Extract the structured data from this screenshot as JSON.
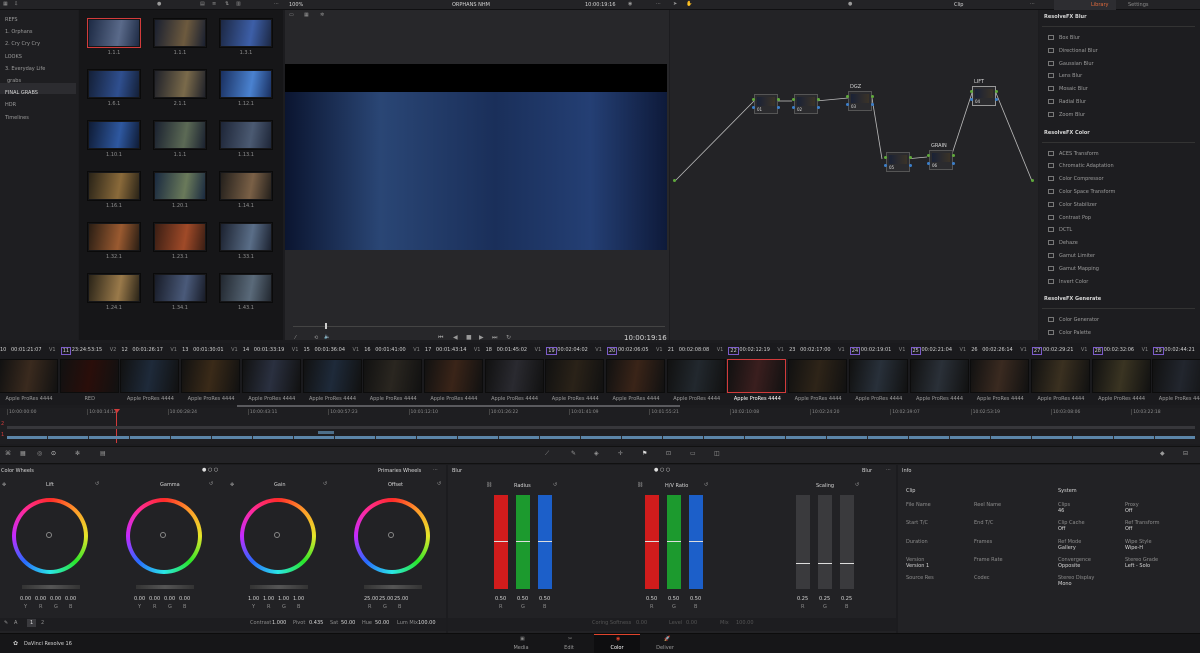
{
  "viewer": {
    "zoom": "100%",
    "title": "ORPHANS NHM",
    "timecode": "10:00:19:16",
    "tc_bottom": "10:00:19:16"
  },
  "gallery": {
    "albums": [
      "REFS",
      "1. Orphans",
      "2. Cry Cry Cry",
      "LOOKS",
      "3. Everyday Life",
      "grabs",
      "FINAL GRABS",
      "HDR",
      "Timelines"
    ],
    "stills": [
      "1.1.1",
      "1.1.1",
      "1.3.1",
      "1.6.1",
      "2.1.1",
      "1.12.1",
      "1.10.1",
      "1.1.1",
      "1.13.1",
      "1.16.1",
      "1.20.1",
      "1.14.1",
      "1.32.1",
      "1.23.1",
      "1.33.1",
      "1.24.1",
      "1.34.1",
      "1.43.1"
    ]
  },
  "node_editor": {
    "mode": "Clip",
    "nodes": [
      {
        "label": "01"
      },
      {
        "label": "02"
      },
      {
        "label": "03",
        "title": "DGZ"
      },
      {
        "label": "05"
      },
      {
        "label": "06",
        "title": "GRAIN"
      },
      {
        "label": "04",
        "title": "LIFT"
      }
    ]
  },
  "library": {
    "tabs": [
      "Library",
      "Settings"
    ],
    "sections": [
      {
        "title": "ResolveFX Blur",
        "items": [
          "Box Blur",
          "Directional Blur",
          "Gaussian Blur",
          "Lens Blur",
          "Mosaic Blur",
          "Radial Blur",
          "Zoom Blur"
        ]
      },
      {
        "title": "ResolveFX Color",
        "items": [
          "ACES Transform",
          "Chromatic Adaptation",
          "Color Compressor",
          "Color Space Transform",
          "Color Stabilizer",
          "Contrast Pop",
          "DCTL",
          "Dehaze",
          "Gamut Limiter",
          "Gamut Mapping",
          "Invert Color"
        ]
      },
      {
        "title": "ResolveFX Generate",
        "items": [
          "Color Generator",
          "Color Palette"
        ]
      }
    ]
  },
  "timeline": {
    "clips": [
      {
        "n": "10",
        "tc": "00:01:21:07",
        "t": "V1",
        "lbl": "Apple ProRes 4444"
      },
      {
        "n": "11",
        "tc": "23:24:53:15",
        "t": "V2",
        "lbl": "RED"
      },
      {
        "n": "12",
        "tc": "00:01:26:17",
        "t": "V1",
        "lbl": "Apple ProRes 4444"
      },
      {
        "n": "13",
        "tc": "00:01:30:01",
        "t": "V1",
        "lbl": "Apple ProRes 4444"
      },
      {
        "n": "14",
        "tc": "00:01:33:19",
        "t": "V1",
        "lbl": "Apple ProRes 4444"
      },
      {
        "n": "15",
        "tc": "00:01:36:04",
        "t": "V1",
        "lbl": "Apple ProRes 4444"
      },
      {
        "n": "16",
        "tc": "00:01:41:00",
        "t": "V1",
        "lbl": "Apple ProRes 4444"
      },
      {
        "n": "17",
        "tc": "00:01:43:14",
        "t": "V1",
        "lbl": "Apple ProRes 4444"
      },
      {
        "n": "18",
        "tc": "00:01:45:02",
        "t": "V1",
        "lbl": "Apple ProRes 4444"
      },
      {
        "n": "19",
        "tc": "00:02:04:02",
        "t": "V1",
        "lbl": "Apple ProRes 4444"
      },
      {
        "n": "20",
        "tc": "00:02:06:05",
        "t": "V1",
        "lbl": "Apple ProRes 4444"
      },
      {
        "n": "21",
        "tc": "00:02:08:08",
        "t": "V1",
        "lbl": "Apple ProRes 4444"
      },
      {
        "n": "22",
        "tc": "00:02:12:19",
        "t": "V1",
        "lbl": "Apple ProRes 4444"
      },
      {
        "n": "23",
        "tc": "00:02:17:00",
        "t": "V1",
        "lbl": "Apple ProRes 4444"
      },
      {
        "n": "24",
        "tc": "00:02:19:01",
        "t": "V1",
        "lbl": "Apple ProRes 4444"
      },
      {
        "n": "25",
        "tc": "00:02:21:04",
        "t": "V1",
        "lbl": "Apple ProRes 4444"
      },
      {
        "n": "26",
        "tc": "00:02:26:14",
        "t": "V1",
        "lbl": "Apple ProRes 4444"
      },
      {
        "n": "27",
        "tc": "00:02:29:21",
        "t": "V1",
        "lbl": "Apple ProRes 4444"
      },
      {
        "n": "28",
        "tc": "00:02:32:06",
        "t": "V1",
        "lbl": "Apple ProRes 4444"
      },
      {
        "n": "29",
        "tc": "00:02:44:21",
        "t": "V1",
        "lbl": "Apple ProRes 4444"
      }
    ],
    "ruler": [
      "10:00:00:00",
      "10:00:14:12",
      "10:00:28:24",
      "10:00:43:11",
      "10:00:57:23",
      "10:01:12:10",
      "10:01:26:22",
      "10:01:41:09",
      "10:01:55:21",
      "10:02:10:08",
      "10:02:24:20",
      "10:02:39:07",
      "10:02:53:19",
      "10:03:08:06",
      "10:03:22:18"
    ]
  },
  "color_wheels": {
    "title": "Color Wheels",
    "mode": "Primaries Wheels",
    "wheels": [
      {
        "name": "Lift",
        "vals": [
          "0.00",
          "0.00",
          "0.00",
          "0.00"
        ]
      },
      {
        "name": "Gamma",
        "vals": [
          "0.00",
          "0.00",
          "0.00",
          "0.00"
        ]
      },
      {
        "name": "Gain",
        "vals": [
          "1.00",
          "1.00",
          "1.00",
          "1.00"
        ]
      },
      {
        "name": "Offset",
        "vals": [
          "25.00",
          "25.00",
          "25.00"
        ]
      }
    ],
    "channels4": [
      "Y",
      "R",
      "G",
      "B"
    ],
    "channels3": [
      "R",
      "G",
      "B"
    ],
    "footer": {
      "page": "1",
      "page2": "2",
      "contrast_l": "Contrast",
      "contrast": "1.000",
      "pivot_l": "Pivot",
      "pivot": "0.435",
      "sat_l": "Sat",
      "sat": "50.00",
      "hue_l": "Hue",
      "hue": "50.00",
      "lummix_l": "Lum Mix",
      "lummix": "100.00"
    }
  },
  "blur": {
    "title": "Blur",
    "mode": "Blur",
    "cols": [
      {
        "name": "Radius",
        "vals": [
          "0.50",
          "0.50",
          "0.50"
        ]
      },
      {
        "name": "H/V Ratio",
        "vals": [
          "0.50",
          "0.50",
          "0.50"
        ]
      },
      {
        "name": "Scaling",
        "vals": [
          "0.25",
          "0.25",
          "0.25"
        ]
      }
    ],
    "footer": {
      "c_l": "Coring Softness",
      "c": "0.00",
      "l_l": "Level",
      "l": "0.00",
      "m_l": "Mix",
      "m": "100.00"
    }
  },
  "info": {
    "title": "Info",
    "clip": {
      "heading": "Clip",
      "rows": [
        [
          "File Name",
          ""
        ],
        [
          "Reel Name",
          ""
        ],
        [
          "Start T/C",
          ""
        ],
        [
          "End T/C",
          ""
        ],
        [
          "Duration",
          ""
        ],
        [
          "Frames",
          ""
        ],
        [
          "Version",
          "Version 1"
        ],
        [
          "Frame Rate",
          ""
        ],
        [
          "Source Res",
          ""
        ],
        [
          "Codec",
          ""
        ]
      ]
    },
    "system": {
      "heading": "System",
      "rows": [
        [
          "Clips",
          "46"
        ],
        [
          "Proxy",
          "Off"
        ],
        [
          "Clip Cache",
          "Off"
        ],
        [
          "Ref Transform",
          "Off"
        ],
        [
          "Ref Mode",
          "Gallery"
        ],
        [
          "Wipe Style",
          "Wipe-H"
        ],
        [
          "Convergence",
          "Opposite"
        ],
        [
          "Stereo Grade",
          "Left - Solo"
        ],
        [
          "Stereo Display",
          "Mono"
        ]
      ]
    }
  },
  "bottom": {
    "app": "DaVinci Resolve 16",
    "tabs": [
      "Media",
      "Edit",
      "Color",
      "Deliver"
    ]
  },
  "colors": {
    "accent": "#d23b3b",
    "selected_tab": "#e0442c"
  }
}
